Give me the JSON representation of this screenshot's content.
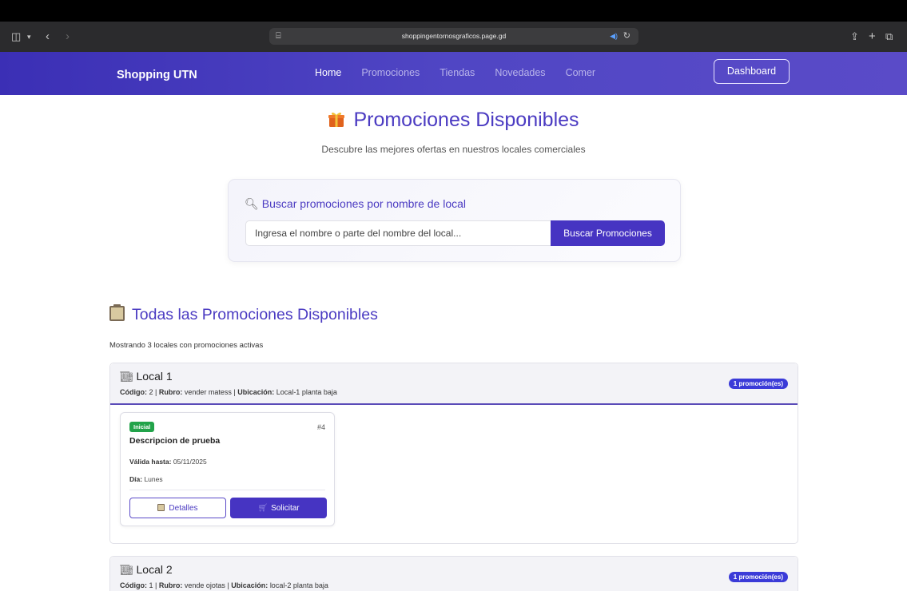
{
  "browser": {
    "url": "shoppingentornosgraficos.page.gd",
    "icons": [
      "sidebar-icon",
      "chevron-down-icon",
      "back-icon",
      "forward-icon",
      "tab-settings-icon",
      "audio-icon",
      "reload-icon",
      "share-icon",
      "new-tab-icon",
      "tabs-overview-icon"
    ]
  },
  "nav": {
    "brand": "Shopping UTN",
    "links": [
      "Home",
      "Promociones",
      "Tiendas",
      "Novedades",
      "Comer"
    ],
    "active": "Home",
    "dashboard": "Dashboard"
  },
  "hero": {
    "title": "Promociones Disponibles",
    "subtitle": "Descubre las mejores ofertas en nuestros locales comerciales"
  },
  "search": {
    "title": "Buscar promociones por nombre de local",
    "placeholder": "Ingresa el nombre o parte del nombre del local...",
    "button": "Buscar Promociones"
  },
  "section": {
    "title": "Todas las Promociones Disponibles",
    "showing": "Mostrando 3 locales con promociones activas"
  },
  "locales": [
    {
      "name": "Local 1",
      "codigo_label": "Código:",
      "codigo": "2",
      "rubro_label": "Rubro:",
      "rubro": "vender matess",
      "ubicacion_label": "Ubicación:",
      "ubicacion": "Local-1 planta baja",
      "count": "1 promoción(es)",
      "promos": [
        {
          "badge": "Inicial",
          "number": "#4",
          "description": "Descripcion de prueba",
          "valid_label": "Válida hasta:",
          "valid": "05/11/2025",
          "day_label": "Día:",
          "day": "Lunes",
          "details": "Detalles",
          "request": "Solicitar"
        }
      ]
    },
    {
      "name": "Local 2",
      "codigo_label": "Código:",
      "codigo": "1",
      "rubro_label": "Rubro:",
      "rubro": "vende ojotas",
      "ubicacion_label": "Ubicación:",
      "ubicacion": "local-2 planta baja",
      "count": "1 promoción(es)"
    }
  ],
  "colors": {
    "primary": "#4634c2",
    "nav_bg": "#4a3fc0",
    "badge_green": "#22a34a",
    "count_badge": "#3b3bd8"
  }
}
